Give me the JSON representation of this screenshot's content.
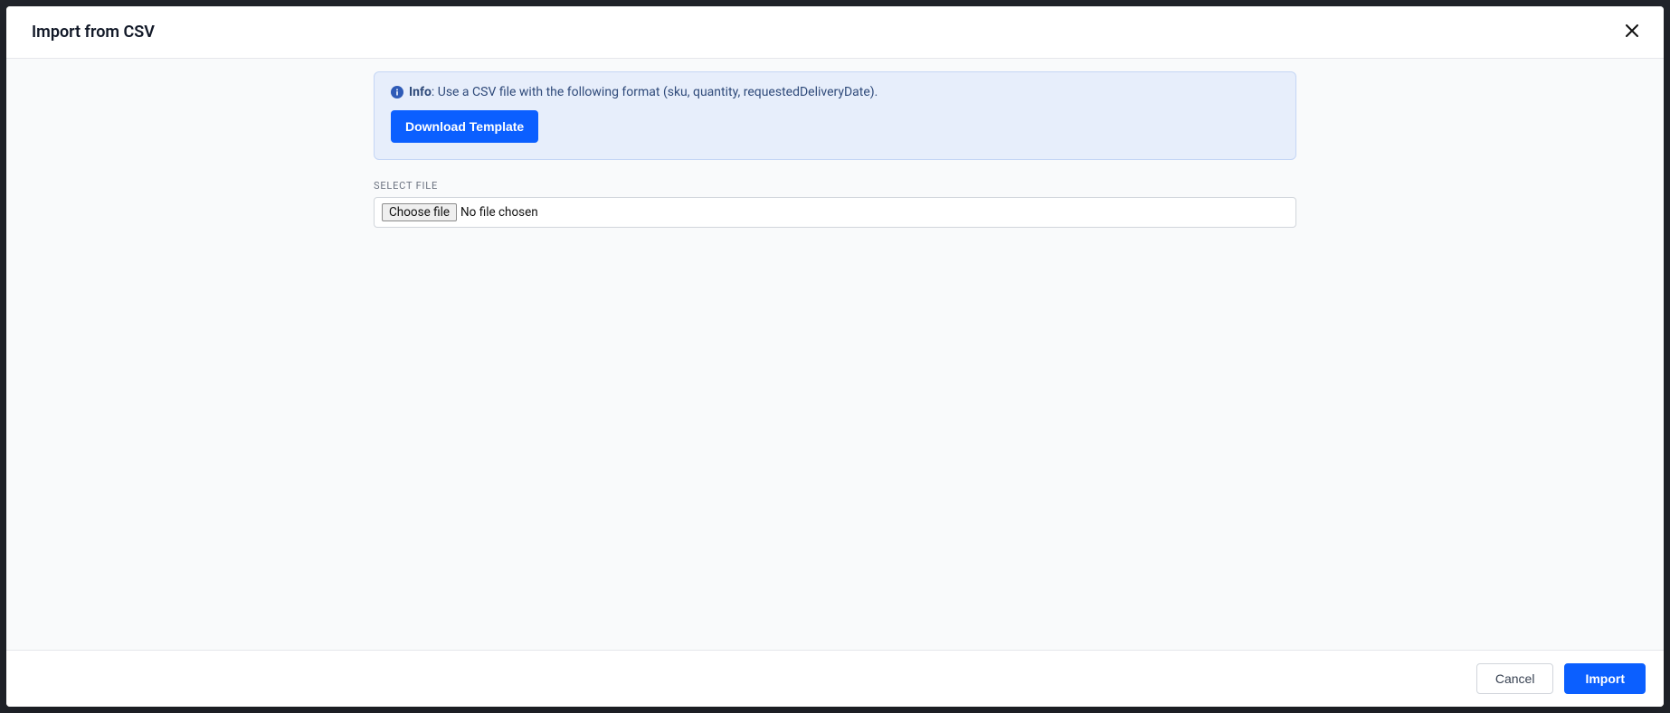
{
  "modal": {
    "title": "Import from CSV",
    "info": {
      "label": "Info",
      "separator": ": ",
      "text": "Use a CSV file with the following format (sku, quantity, requestedDeliveryDate).",
      "download_label": "Download Template"
    },
    "file_field": {
      "label": "SELECT FILE",
      "choose_label": "Choose file",
      "status": "No file chosen"
    },
    "footer": {
      "cancel_label": "Cancel",
      "import_label": "Import"
    }
  }
}
